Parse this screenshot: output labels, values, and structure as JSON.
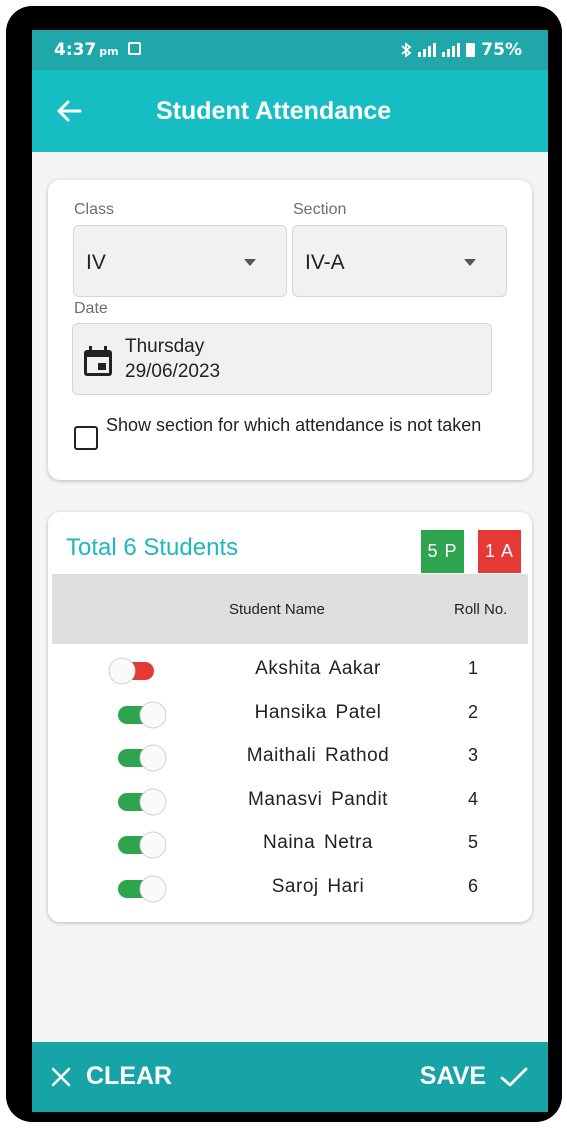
{
  "status_bar": {
    "time": "4:37",
    "ampm": "pm",
    "battery": "75%"
  },
  "app_bar": {
    "title": "Student Attendance"
  },
  "filters": {
    "class_label": "Class",
    "class_value": "IV",
    "section_label": "Section",
    "section_value": "IV-A",
    "date_label": "Date",
    "date_day": "Thursday",
    "date_value": "29/06/2023",
    "checkbox_label": "Show section for which attendance is not taken",
    "checkbox_checked": false
  },
  "summary": {
    "total": "Total 6 Students",
    "present": "5 P",
    "absent": "1 A"
  },
  "table": {
    "header_name": "Student Name",
    "header_roll": "Roll No.",
    "rows": [
      {
        "name": "Akshita  Aakar",
        "roll": "1",
        "present": false
      },
      {
        "name": "Hansika  Patel",
        "roll": "2",
        "present": true
      },
      {
        "name": "Maithali  Rathod",
        "roll": "3",
        "present": true
      },
      {
        "name": "Manasvi  Pandit",
        "roll": "4",
        "present": true
      },
      {
        "name": "Naina  Netra",
        "roll": "5",
        "present": true
      },
      {
        "name": "Saroj  Hari",
        "roll": "6",
        "present": true
      }
    ]
  },
  "bottom_bar": {
    "clear_label": "CLEAR",
    "save_label": "SAVE"
  },
  "colors": {
    "teal": "#16bec3",
    "present_green": "#2ea44f",
    "absent_red": "#e53935",
    "toggle_on": "#2ea44f",
    "toggle_off": "#e53935"
  }
}
